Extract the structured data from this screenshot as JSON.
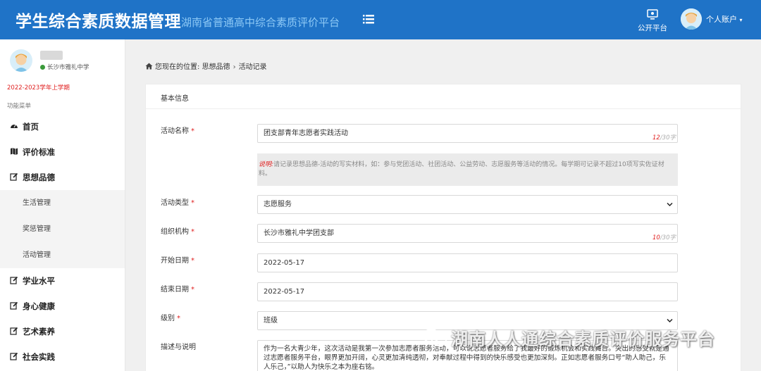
{
  "header": {
    "title": "学生综合素质数据管理",
    "subtitle": "湖南省普通高中综合素质评价平台",
    "public_platform_label": "公开平台",
    "account_label": "个人账户"
  },
  "sidebar": {
    "school": "长沙市雅礼中学",
    "semester": "2022-2023学年上学期",
    "menu_caption": "功能菜单",
    "items": [
      {
        "label": "首页",
        "icon": "dashboard-icon"
      },
      {
        "label": "评价标准",
        "icon": "map-icon"
      },
      {
        "label": "思想品德",
        "icon": "edit-icon"
      },
      {
        "label": "生活管理"
      },
      {
        "label": "奖惩管理"
      },
      {
        "label": "活动管理"
      },
      {
        "label": "学业水平",
        "icon": "edit-icon"
      },
      {
        "label": "身心健康",
        "icon": "edit-icon"
      },
      {
        "label": "艺术素养",
        "icon": "edit-icon"
      },
      {
        "label": "社会实践",
        "icon": "edit-icon"
      }
    ]
  },
  "breadcrumb": {
    "prefix": "您现在的位置:",
    "level1": "思想品德",
    "level2": "活动记录"
  },
  "form": {
    "section_title": "基本信息",
    "required_mark": "*",
    "activity_name": {
      "label": "活动名称",
      "value": "团支部青年志愿者实践活动",
      "count": "12",
      "max": "/30字"
    },
    "note": {
      "prefix": "说明:",
      "text": "请记录思想品德-活动的写实材料，如：参与党团活动、社团活动、公益劳动、志愿服务等活动的情况。每学期可记录不超过10项写实佐证材料。"
    },
    "activity_type": {
      "label": "活动类型",
      "value": "志愿服务"
    },
    "organization": {
      "label": "组织机构",
      "value": "长沙市雅礼中学团支部",
      "count": "10",
      "max": "/30字"
    },
    "start_date": {
      "label": "开始日期",
      "value": "2022-05-17"
    },
    "end_date": {
      "label": "结束日期",
      "value": "2022-05-17"
    },
    "level": {
      "label": "级别",
      "value": "班级"
    },
    "description": {
      "label": "描述与说明",
      "value": "作为一名大青少年，这次活动是我第一次参加志愿者服务活动，可以说志愿者服务给了我最好的锻炼机会和实践舞台。突出的感受就是通过志愿者服务平台，眼界更加开阔，心灵更加清纯透彻，对奉献过程中得到的快乐感受也更加深刻。正如志愿者服务口号“助人助己，乐人乐己，”以助人为快乐之本为座右铭。"
    }
  },
  "watermark": "湖南人人通综合素质评价服务平台",
  "colors": {
    "header_bg": "#1f73c7",
    "subtitle": "#8cc8f5",
    "required": "#e02020",
    "online_dot": "#3a9a3a"
  }
}
